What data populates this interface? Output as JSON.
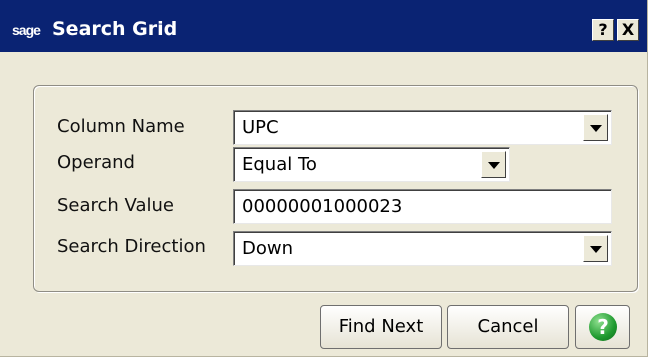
{
  "window": {
    "logo_text": "sage",
    "title": "Search Grid",
    "help_button_label": "?",
    "close_button_label": "X"
  },
  "form": {
    "column_name": {
      "label": "Column Name",
      "value": "UPC"
    },
    "operand": {
      "label": "Operand",
      "value": "Equal To"
    },
    "search_value": {
      "label": "Search Value",
      "value": "00000001000023"
    },
    "search_direction": {
      "label": "Search Direction",
      "value": "Down"
    }
  },
  "buttons": {
    "find_next": "Find Next",
    "cancel": "Cancel",
    "help": "?"
  },
  "colors": {
    "titlebar": "#0a2373",
    "dialog_bg": "#ece9d8",
    "help_green": "#1f9a2f"
  }
}
